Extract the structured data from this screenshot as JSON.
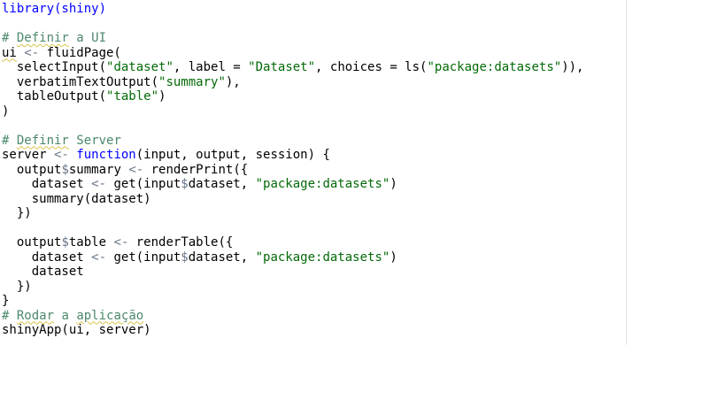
{
  "editor": {
    "lines": [
      [
        {
          "t": "library(shiny)",
          "c": "keyword"
        }
      ],
      [],
      [
        {
          "t": "# ",
          "c": "comment"
        },
        {
          "t": "Definir",
          "c": "comment spell"
        },
        {
          "t": " a UI",
          "c": "comment"
        }
      ],
      [
        {
          "t": "ui",
          "c": "plain spell"
        },
        {
          "t": " <- ",
          "c": "op"
        },
        {
          "t": "fluidPage(",
          "c": "plain"
        }
      ],
      [
        {
          "t": "  selectInput(",
          "c": "plain"
        },
        {
          "t": "\"dataset\"",
          "c": "string"
        },
        {
          "t": ", label = ",
          "c": "plain"
        },
        {
          "t": "\"Dataset\"",
          "c": "string"
        },
        {
          "t": ", choices = ls(",
          "c": "plain"
        },
        {
          "t": "\"package:datasets\"",
          "c": "string"
        },
        {
          "t": ")),",
          "c": "plain"
        }
      ],
      [
        {
          "t": "  verbatimTextOutput(",
          "c": "plain"
        },
        {
          "t": "\"summary\"",
          "c": "string"
        },
        {
          "t": "),",
          "c": "plain"
        }
      ],
      [
        {
          "t": "  tableOutput(",
          "c": "plain"
        },
        {
          "t": "\"table\"",
          "c": "string"
        },
        {
          "t": ")",
          "c": "plain"
        }
      ],
      [
        {
          "t": ")",
          "c": "plain"
        }
      ],
      [],
      [
        {
          "t": "# ",
          "c": "comment"
        },
        {
          "t": "Definir",
          "c": "comment spell"
        },
        {
          "t": " Server",
          "c": "comment"
        }
      ],
      [
        {
          "t": "server",
          "c": "plain"
        },
        {
          "t": " <- ",
          "c": "op"
        },
        {
          "t": "function",
          "c": "keyword"
        },
        {
          "t": "(input, output, session) {",
          "c": "plain"
        }
      ],
      [
        {
          "t": "  output",
          "c": "plain"
        },
        {
          "t": "$",
          "c": "op"
        },
        {
          "t": "summary",
          "c": "plain"
        },
        {
          "t": " <- ",
          "c": "op"
        },
        {
          "t": "renderPrint({",
          "c": "plain"
        }
      ],
      [
        {
          "t": "    dataset",
          "c": "plain"
        },
        {
          "t": " <- ",
          "c": "op"
        },
        {
          "t": "get(input",
          "c": "plain"
        },
        {
          "t": "$",
          "c": "op"
        },
        {
          "t": "dataset, ",
          "c": "plain"
        },
        {
          "t": "\"package:datasets\"",
          "c": "string"
        },
        {
          "t": ")",
          "c": "plain"
        }
      ],
      [
        {
          "t": "    summary(dataset)",
          "c": "plain"
        }
      ],
      [
        {
          "t": "  })",
          "c": "plain"
        }
      ],
      [],
      [
        {
          "t": "  output",
          "c": "plain"
        },
        {
          "t": "$",
          "c": "op"
        },
        {
          "t": "table",
          "c": "plain"
        },
        {
          "t": " <- ",
          "c": "op"
        },
        {
          "t": "renderTable({",
          "c": "plain"
        }
      ],
      [
        {
          "t": "    dataset",
          "c": "plain"
        },
        {
          "t": " <- ",
          "c": "op"
        },
        {
          "t": "get(input",
          "c": "plain"
        },
        {
          "t": "$",
          "c": "op"
        },
        {
          "t": "dataset, ",
          "c": "plain"
        },
        {
          "t": "\"package:datasets\"",
          "c": "string"
        },
        {
          "t": ")",
          "c": "plain"
        }
      ],
      [
        {
          "t": "    dataset",
          "c": "plain"
        }
      ],
      [
        {
          "t": "  })",
          "c": "plain"
        }
      ],
      [
        {
          "t": "}",
          "c": "plain"
        }
      ],
      [
        {
          "t": "# ",
          "c": "comment"
        },
        {
          "t": "Rodar",
          "c": "comment spell"
        },
        {
          "t": " a ",
          "c": "comment"
        },
        {
          "t": "aplicação",
          "c": "comment spell"
        }
      ],
      [
        {
          "t": "shinyApp(ui, server)",
          "c": "plain"
        }
      ]
    ]
  },
  "colors": {
    "background": "#ffffff",
    "plain": "#000000",
    "comment": "#4c886b",
    "string": "#036a07",
    "keyword": "#0000ff",
    "operator": "#687687",
    "margin_line": "#e4e4e4"
  }
}
